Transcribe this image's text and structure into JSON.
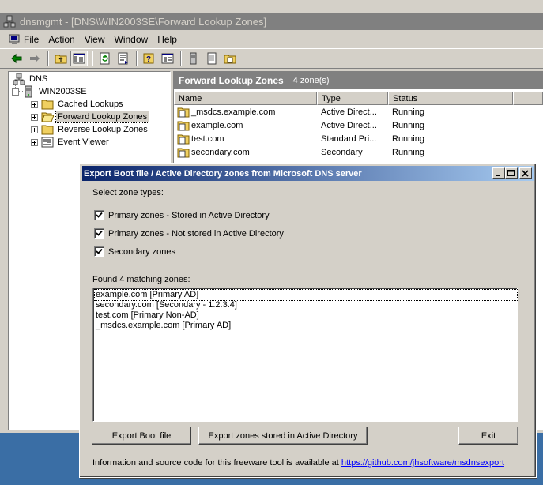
{
  "mmc": {
    "title": "dnsmgmt - [DNS\\WIN2003SE\\Forward Lookup Zones]",
    "menu": [
      "File",
      "Action",
      "View",
      "Window",
      "Help"
    ],
    "tree": {
      "root": "DNS",
      "server": "WIN2003SE",
      "children": [
        "Cached Lookups",
        "Forward Lookup Zones",
        "Reverse Lookup Zones",
        "Event Viewer"
      ],
      "selected": "Forward Lookup Zones"
    },
    "panel": {
      "heading": "Forward Lookup Zones",
      "count": "4 zone(s)",
      "columns": [
        "Name",
        "Type",
        "Status"
      ],
      "rows": [
        {
          "name": "_msdcs.example.com",
          "type": "Active Direct...",
          "status": "Running"
        },
        {
          "name": "example.com",
          "type": "Active Direct...",
          "status": "Running"
        },
        {
          "name": "test.com",
          "type": "Standard Pri...",
          "status": "Running"
        },
        {
          "name": "secondary.com",
          "type": "Secondary",
          "status": "Running"
        }
      ]
    }
  },
  "dialog": {
    "title": "Export Boot file / Active Directory zones from Microsoft DNS server",
    "select_label": "Select zone types:",
    "checkboxes": [
      {
        "label": "Primary zones - Stored in Active Directory",
        "checked": true
      },
      {
        "label": "Primary zones - Not stored in Active Directory",
        "checked": true
      },
      {
        "label": "Secondary zones",
        "checked": true
      }
    ],
    "found_label": "Found 4 matching zones:",
    "zones": [
      "example.com [Primary AD]",
      "secondary.com [Secondary - 1.2.3.4]",
      "test.com [Primary Non-AD]",
      "_msdcs.example.com [Primary AD]"
    ],
    "buttons": {
      "export_boot": "Export Boot file",
      "export_ad": "Export zones stored in Active Directory",
      "exit": "Exit"
    },
    "info_text": "Information and source code for this freeware tool is available at",
    "info_link": "https://github.com/jhsoftware/msdnsexport"
  },
  "colors": {
    "desktop": "#3a6ea5",
    "dialog_caption_start": "#0a246a",
    "dialog_caption_end": "#a6caf0",
    "inactive_caption": "#808080",
    "face": "#d4d0c8"
  }
}
